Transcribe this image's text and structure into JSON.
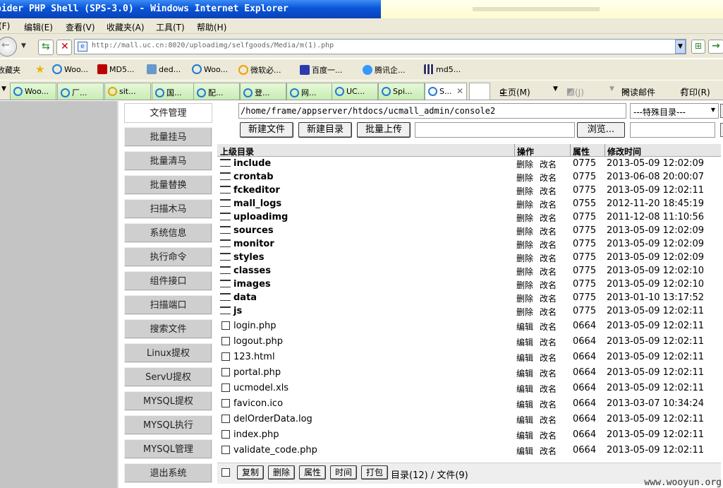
{
  "window": {
    "title": "pider PHP Shell (SPS-3.0) - Windows Internet Explorer"
  },
  "menu": [
    "(F)",
    "编辑(E)",
    "查看(V)",
    "收藏夹(A)",
    "工具(T)",
    "帮助(H)"
  ],
  "address": {
    "url": "http://mall.uc.cn:8020/uploadimg/selfgoods/Media/m(1).php"
  },
  "favorites": [
    "收藏夹",
    "Woo...",
    "MD5...",
    "ded...",
    "Woo...",
    "微软必...",
    "百度一...",
    "腾讯企...",
    "md5..."
  ],
  "tabs": [
    "Woo...",
    "厂...",
    "sit...",
    "国...",
    "配...",
    "登...",
    "网...",
    "UC...",
    "Spi...",
    "S..."
  ],
  "toolbar_right": {
    "home": "主页(M)",
    "feeds": "源(J)",
    "read_mail": "阅读邮件",
    "print": "打印(R)"
  },
  "sidebar": [
    "文件管理",
    "批量挂马",
    "批量清马",
    "批量替换",
    "扫描木马",
    "系统信息",
    "执行命令",
    "组件接口",
    "扫描端口",
    "搜索文件",
    "Linux提权",
    "ServU提权",
    "MYSQL提权",
    "MYSQL执行",
    "MYSQL管理",
    "退出系统"
  ],
  "form": {
    "path": "/home/frame/appserver/htdocs/ucmall_admin/console2",
    "special_dir": "---特殊目录---",
    "new_file": "新建文件",
    "new_dir": "新建目录",
    "batch_upload": "批量上传",
    "browse": "浏览..."
  },
  "table": {
    "headers": {
      "parent": "上级目录",
      "ops": "操作",
      "attr": "属性",
      "mtime": "修改时间"
    },
    "dirs": [
      {
        "name": "include",
        "op1": "删除",
        "op2": "改名",
        "attr": "0775",
        "mtime": "2013-05-09 12:02:09"
      },
      {
        "name": "crontab",
        "op1": "删除",
        "op2": "改名",
        "attr": "0775",
        "mtime": "2013-06-08 20:00:07"
      },
      {
        "name": "fckeditor",
        "op1": "删除",
        "op2": "改名",
        "attr": "0775",
        "mtime": "2013-05-09 12:02:11"
      },
      {
        "name": "mall_logs",
        "op1": "删除",
        "op2": "改名",
        "attr": "0755",
        "mtime": "2012-11-20 18:45:19"
      },
      {
        "name": "uploadimg",
        "op1": "删除",
        "op2": "改名",
        "attr": "0775",
        "mtime": "2011-12-08 11:10:56"
      },
      {
        "name": "sources",
        "op1": "删除",
        "op2": "改名",
        "attr": "0775",
        "mtime": "2013-05-09 12:02:09"
      },
      {
        "name": "monitor",
        "op1": "删除",
        "op2": "改名",
        "attr": "0775",
        "mtime": "2013-05-09 12:02:09"
      },
      {
        "name": "styles",
        "op1": "删除",
        "op2": "改名",
        "attr": "0775",
        "mtime": "2013-05-09 12:02:09"
      },
      {
        "name": "classes",
        "op1": "删除",
        "op2": "改名",
        "attr": "0775",
        "mtime": "2013-05-09 12:02:10"
      },
      {
        "name": "images",
        "op1": "删除",
        "op2": "改名",
        "attr": "0775",
        "mtime": "2013-05-09 12:02:10"
      },
      {
        "name": "data",
        "op1": "删除",
        "op2": "改名",
        "attr": "0775",
        "mtime": "2013-01-10 13:17:52"
      },
      {
        "name": "js",
        "op1": "删除",
        "op2": "改名",
        "attr": "0775",
        "mtime": "2013-05-09 12:02:11"
      }
    ],
    "files": [
      {
        "name": "login.php",
        "op1": "编辑",
        "op2": "改名",
        "attr": "0664",
        "mtime": "2013-05-09 12:02:11"
      },
      {
        "name": "logout.php",
        "op1": "编辑",
        "op2": "改名",
        "attr": "0664",
        "mtime": "2013-05-09 12:02:11"
      },
      {
        "name": "123.html",
        "op1": "编辑",
        "op2": "改名",
        "attr": "0664",
        "mtime": "2013-05-09 12:02:11"
      },
      {
        "name": "portal.php",
        "op1": "编辑",
        "op2": "改名",
        "attr": "0664",
        "mtime": "2013-05-09 12:02:11"
      },
      {
        "name": "ucmodel.xls",
        "op1": "编辑",
        "op2": "改名",
        "attr": "0664",
        "mtime": "2013-05-09 12:02:11"
      },
      {
        "name": "favicon.ico",
        "op1": "编辑",
        "op2": "改名",
        "attr": "0664",
        "mtime": "2013-03-07 10:34:24"
      },
      {
        "name": "delOrderData.log",
        "op1": "编辑",
        "op2": "改名",
        "attr": "0664",
        "mtime": "2013-05-09 12:02:11"
      },
      {
        "name": "index.php",
        "op1": "编辑",
        "op2": "改名",
        "attr": "0664",
        "mtime": "2013-05-09 12:02:11"
      },
      {
        "name": "validate_code.php",
        "op1": "编辑",
        "op2": "改名",
        "attr": "0664",
        "mtime": "2013-05-09 12:02:11"
      }
    ]
  },
  "footer": {
    "copy": "复制",
    "delete": "删除",
    "attr": "属性",
    "time": "时间",
    "pack": "打包",
    "summary": "目录(12) / 文件(9)"
  },
  "watermark": "www.wooyun.org"
}
